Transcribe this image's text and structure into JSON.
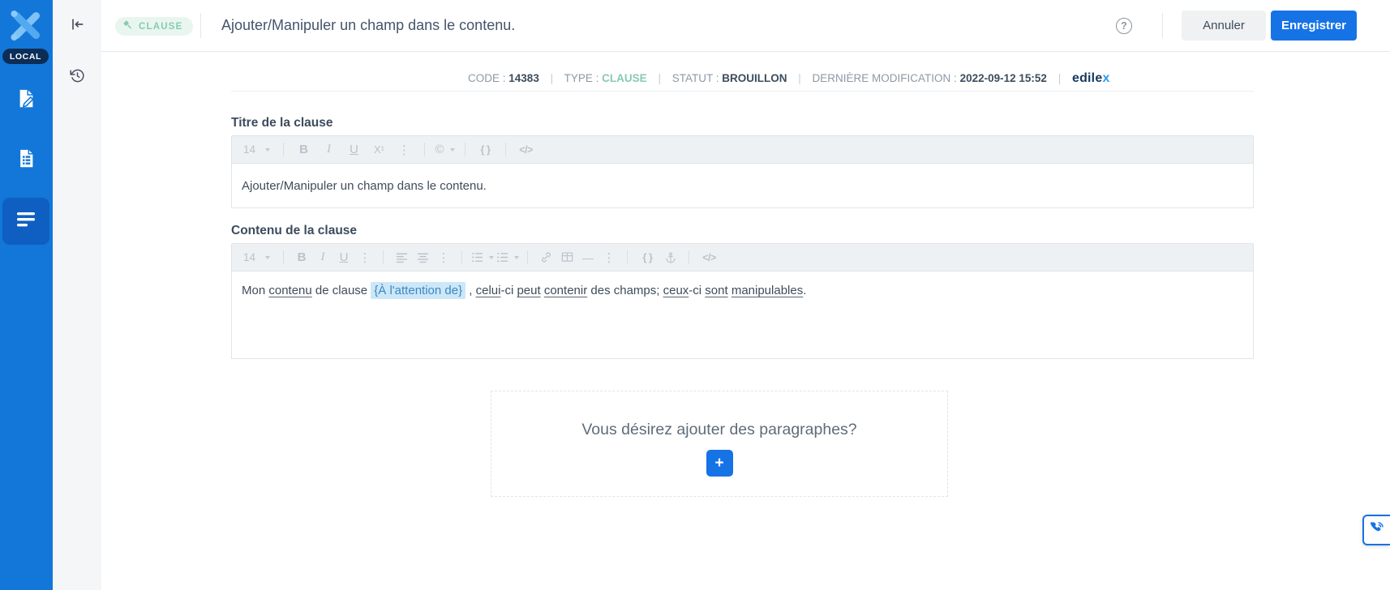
{
  "colors": {
    "sidebar_blue": "#1277d8",
    "sidebar_selected_blue": "#0e5fc1",
    "local_badge_bg": "#0b2d56",
    "accent_blue": "#1673e6",
    "badge_teal_text": "#86cbb0",
    "badge_teal_bg": "#e9f6f0",
    "text_dark": "#3d4c5c",
    "label_muted": "#8d99a6",
    "field_bg": "#cbe7f8",
    "field_text": "#3f87c0",
    "brand_navy": "#16395f",
    "brand_x_blue": "#2e9bf0",
    "toolbar_icon": "#b9c2cb"
  },
  "glyphs": {
    "bold": "B",
    "italic": "I",
    "underline": "U",
    "superscript": "X¹",
    "more": "⋮",
    "copyright": "©",
    "braces": "{ }",
    "source": "</>",
    "hr": "—",
    "pipe": "|",
    "help": "?",
    "add": "+"
  },
  "sidebar": {
    "local_badge": "LOCAL"
  },
  "header": {
    "badge": "CLAUSE",
    "title": "Ajouter/Manipuler un champ dans le contenu.",
    "cancel_label": "Annuler",
    "save_label": "Enregistrer"
  },
  "meta": {
    "code_label": "CODE :",
    "code_value": "14383",
    "type_label": "TYPE :",
    "type_value": "CLAUSE",
    "status_label": "STATUT :",
    "status_value": "BROUILLON",
    "modified_label": "DERNIÈRE MODIFICATION :",
    "modified_value": "2022-09-12 15:52",
    "brand_main": "edile",
    "brand_accent": "x"
  },
  "title_editor": {
    "heading": "Titre de la clause",
    "font_size": "14",
    "content": "Ajouter/Manipuler un champ dans le contenu."
  },
  "content_editor": {
    "heading": "Contenu de la clause",
    "font_size": "14",
    "segments": [
      {
        "text": "Mon ",
        "style": "plain"
      },
      {
        "text": "contenu",
        "style": "underline"
      },
      {
        "text": " de clause ",
        "style": "plain"
      },
      {
        "text": "{À l'attention de}",
        "style": "field"
      },
      {
        "text": " , ",
        "style": "plain"
      },
      {
        "text": "celui",
        "style": "underline"
      },
      {
        "text": "-ci ",
        "style": "plain"
      },
      {
        "text": "peut",
        "style": "underline"
      },
      {
        "text": " ",
        "style": "plain"
      },
      {
        "text": "contenir",
        "style": "underline"
      },
      {
        "text": " des champs; ",
        "style": "plain"
      },
      {
        "text": "ceux",
        "style": "underline"
      },
      {
        "text": "-ci ",
        "style": "plain"
      },
      {
        "text": "sont",
        "style": "underline"
      },
      {
        "text": " ",
        "style": "plain"
      },
      {
        "text": "manipulables",
        "style": "underline"
      },
      {
        "text": ".",
        "style": "plain"
      }
    ]
  },
  "paragraphs_box": {
    "prompt": "Vous désirez ajouter des paragraphes?"
  }
}
